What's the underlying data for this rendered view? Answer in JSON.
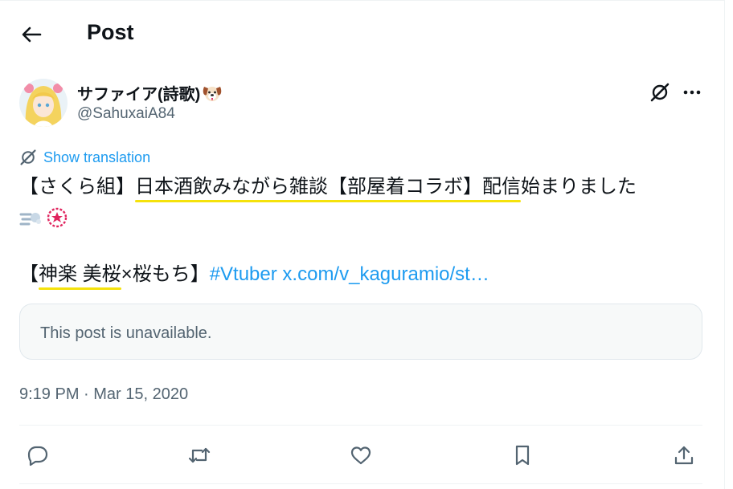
{
  "header": {
    "title": "Post"
  },
  "author": {
    "display_name": "サファイア(詩歌)",
    "name_emoji_icon": "dog-face-icon",
    "handle": "@SahuxaiA84"
  },
  "translate": {
    "label": "Show translation"
  },
  "post": {
    "line1_pre": "【さくら組】",
    "line1_hl1": "日本酒飲みながら雑談【部屋着コラボ】配信",
    "line1_post": "始まりました",
    "line2_emoji": [
      "dash-icon",
      "sakura-badge-icon"
    ],
    "line3_pre": "【",
    "line3_hl": "神楽 美桜",
    "line3_mid": "×桜もち】",
    "hashtag": "#Vtuber",
    "url": "x.com/v_kaguramio/st…"
  },
  "quote": {
    "text": "This post is unavailable."
  },
  "meta": {
    "timestamp": "9:19 PM · Mar 15, 2020"
  },
  "actions": [
    "reply-icon",
    "repost-icon",
    "like-icon",
    "bookmark-icon",
    "share-icon"
  ],
  "colors": {
    "link": "#1d9bf0",
    "highlight": "#f5e20b",
    "secondary_text": "#536471"
  }
}
